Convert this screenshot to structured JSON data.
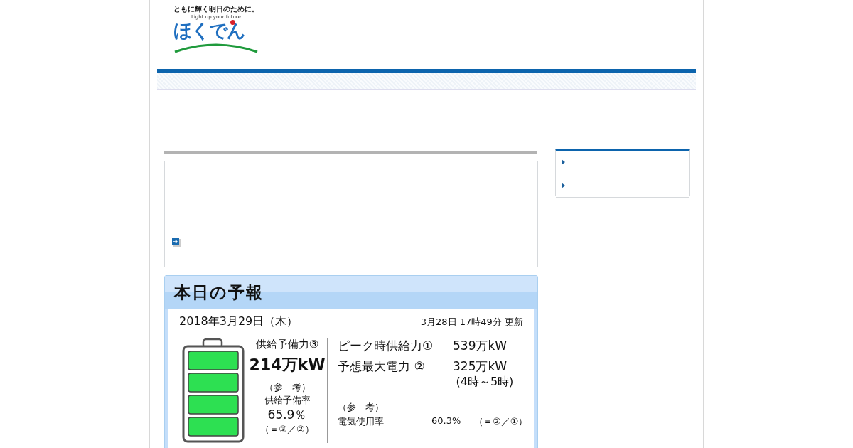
{
  "logo": {
    "tagline": "ともに輝く明日のために。",
    "subtitle": "Light up your future",
    "name": "ほくでん"
  },
  "sidebar": {
    "items": [
      {
        "kind": "link"
      },
      {
        "kind": "link"
      }
    ]
  },
  "forecast": {
    "title": "本日の予報",
    "date": "2018年3月29日（木）",
    "updated": "3月28日 17時49分 更新",
    "battery": {
      "segments": [
        {
          "filled": true
        },
        {
          "filled": true
        },
        {
          "filled": true
        },
        {
          "filled": true
        }
      ]
    },
    "reserve_label": "供給予備力③",
    "reserve_value": "214万kW",
    "reference_label": "（参　考）",
    "reserve_rate_label": "供給予備率",
    "reserve_rate": "65.9％",
    "reserve_rate_formula": "（＝③／②）",
    "rows": [
      {
        "label": "ピーク時供給力①",
        "value": "539万kW"
      },
      {
        "label": "予想最大電力 ②",
        "value": "325万kW",
        "note": "(4時～5時)"
      }
    ],
    "reference_label_2": "（参　考）",
    "usage_label": "電気使用率",
    "usage_value": "60.3%",
    "usage_formula": "（＝②／①）"
  }
}
